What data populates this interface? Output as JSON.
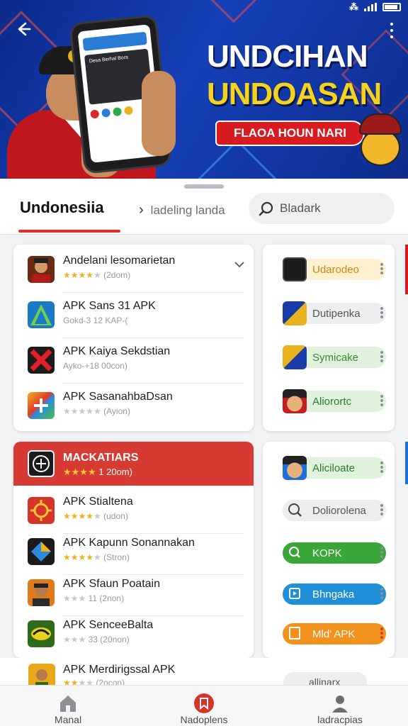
{
  "banner": {
    "title_line1": "UNDCIHAN",
    "title_line2": "UNDOASAN",
    "pill_text": "FLAOA HOUN NARI",
    "phone_screen_text": "Desa Berhal Bora"
  },
  "status_bar": {
    "network": "4G",
    "battery": "full"
  },
  "tabs": {
    "active": "Undonesiia",
    "secondary": "ladeling landa",
    "search_placeholder": "Bladark"
  },
  "card1": {
    "rows": [
      {
        "title": "Andelani lesomarietan",
        "rating": 4,
        "meta": "(2dom)",
        "icon": "portrait-icon",
        "icon_color": "#6b2a12"
      },
      {
        "title": "APK Sans 31 APK",
        "rating": 0,
        "meta": "Gokd-3 12 KAP-(",
        "icon": "blue-a-icon",
        "icon_color": "#1a7ac8"
      },
      {
        "title": "APK Kaiya Sekdstian",
        "rating": 0,
        "meta": "Ayko-+18 00con)",
        "icon": "red-x-icon",
        "icon_color": "#c2131c"
      },
      {
        "title": "APK SasanahbaDsan",
        "rating": 0,
        "meta": "(Ayion)",
        "icon": "plus-icon",
        "icon_color": "#2d8adf"
      }
    ]
  },
  "side1": {
    "rows": [
      {
        "label": "Udarodeo",
        "bg": "#fdf1d2",
        "color": "#c98a10"
      },
      {
        "label": "Dutipenka",
        "bg": "#eceef0",
        "color": "#555"
      },
      {
        "label": "Symicake",
        "bg": "#dff3dc",
        "color": "#3b8a2e"
      },
      {
        "label": "Aliorortc",
        "bg": "#dff3dc",
        "color": "#2a7a2e"
      }
    ]
  },
  "card2": {
    "header": {
      "title": "MACKATIARS",
      "rating": 4,
      "meta": "1 20om)"
    },
    "rows": [
      {
        "title": "APK Stialtena",
        "rating": 4,
        "meta": "(udon)",
        "icon": "sun-icon",
        "icon_color": "#d7332a"
      },
      {
        "title": "APK Kapunn Sonannakan",
        "rating": 4,
        "meta": "(Stron)",
        "icon": "diamond-icon",
        "icon_color": "#1b1b1b"
      },
      {
        "title": "APK Sfaun Poatain",
        "rating": 0,
        "meta": "11 (2non)",
        "icon": "portrait-icon",
        "icon_color": "#e07a1a"
      },
      {
        "title": "APK SenceeBalta",
        "rating": 0,
        "meta": "33 (20non)",
        "icon": "graffiti-icon",
        "icon_color": "#2d6a1a"
      }
    ]
  },
  "side2": {
    "rows": [
      {
        "label": "Aliciloate",
        "bg": "#dff3dc",
        "color": "#2a7a2e",
        "style": "soft"
      },
      {
        "label": "Doliorolena",
        "bg": "#eceef0",
        "color": "#555",
        "style": "soft"
      },
      {
        "label": "KOPK",
        "bg": "#3aa63a",
        "color": "#ffffff",
        "style": "solid"
      },
      {
        "label": "Bhngaka",
        "bg": "#1e8fd8",
        "color": "#ffffff",
        "style": "solid"
      },
      {
        "label": "Mld' APK",
        "bg": "#f2911c",
        "color": "#ffffff",
        "style": "solid"
      }
    ]
  },
  "partial_row": {
    "title": "APK Merdirigssal APK",
    "meta": "(2ocon)",
    "pill": "allinarx"
  },
  "bottom_nav": [
    {
      "label": "Manal",
      "icon": "home-icon"
    },
    {
      "label": "Nadoplens",
      "icon": "bookmark-icon"
    },
    {
      "label": "ladracpias",
      "icon": "profile-icon"
    }
  ]
}
